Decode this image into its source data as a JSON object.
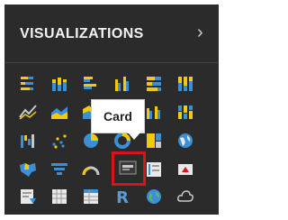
{
  "pane": {
    "title": "VISUALIZATIONS",
    "collapse_icon": "chevron-right-icon"
  },
  "tooltip": {
    "label": "Card"
  },
  "colors": {
    "accent": "#f2c811",
    "selection": "#d9131b",
    "pane_bg": "#2b2b2b"
  },
  "visuals": [
    "stacked-bar-chart-icon",
    "stacked-column-chart-icon",
    "clustered-bar-chart-icon",
    "clustered-column-chart-icon",
    "percent-stacked-bar-chart-icon",
    "percent-stacked-column-chart-icon",
    "line-chart-icon",
    "area-chart-icon",
    "stacked-area-chart-icon",
    "line-and-column-chart-icon",
    "line-and-clustered-column-chart-icon",
    "ribbon-chart-icon",
    "waterfall-chart-icon",
    "scatter-chart-icon",
    "pie-chart-icon",
    "donut-chart-icon",
    "treemap-icon",
    "map-icon",
    "filled-map-icon",
    "funnel-icon",
    "gauge-icon",
    "card-icon",
    "multi-row-card-icon",
    "kpi-icon",
    "slicer-icon",
    "table-icon",
    "matrix-icon",
    "r-script-visual-icon",
    "globe-icon",
    "arcgis-map-icon"
  ]
}
